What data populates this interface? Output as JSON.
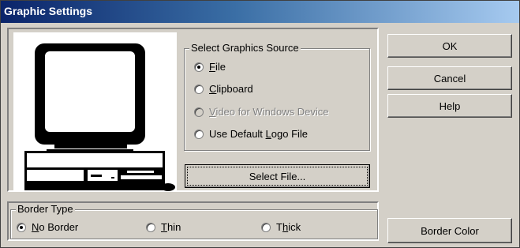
{
  "window": {
    "title": "Graphic Settings"
  },
  "source_group": {
    "title": "Select Graphics Source",
    "options": [
      {
        "label": "File",
        "accel": "F",
        "rest": "ile",
        "selected": true,
        "enabled": true
      },
      {
        "label": "Clipboard",
        "accel": "C",
        "rest": "lipboard",
        "selected": false,
        "enabled": true
      },
      {
        "label": "Video for Windows Device",
        "accel": "V",
        "rest": "ideo for Windows Device",
        "selected": false,
        "enabled": false
      },
      {
        "label": "Use Default Logo File",
        "pre": "Use Default ",
        "accel": "L",
        "rest": "ogo File",
        "selected": false,
        "enabled": true
      }
    ]
  },
  "select_file_button": {
    "label": "Select File..."
  },
  "buttons": {
    "ok": "OK",
    "cancel": "Cancel",
    "help": "Help",
    "border_color": "Border Color"
  },
  "border_group": {
    "title": "Border Type",
    "options": [
      {
        "label": "No Border",
        "accel": "N",
        "rest": "o Border",
        "selected": true
      },
      {
        "label": "Thin",
        "accel": "T",
        "rest": "hin",
        "selected": false
      },
      {
        "label": "Thick",
        "pre": "T",
        "accel": "h",
        "rest": "ick",
        "selected": false
      }
    ]
  },
  "preview": {
    "icon": "computer-monitor-icon"
  },
  "colors": {
    "title_start": "#0a246a",
    "title_end": "#a6caf0",
    "face": "#d4d0c8"
  }
}
